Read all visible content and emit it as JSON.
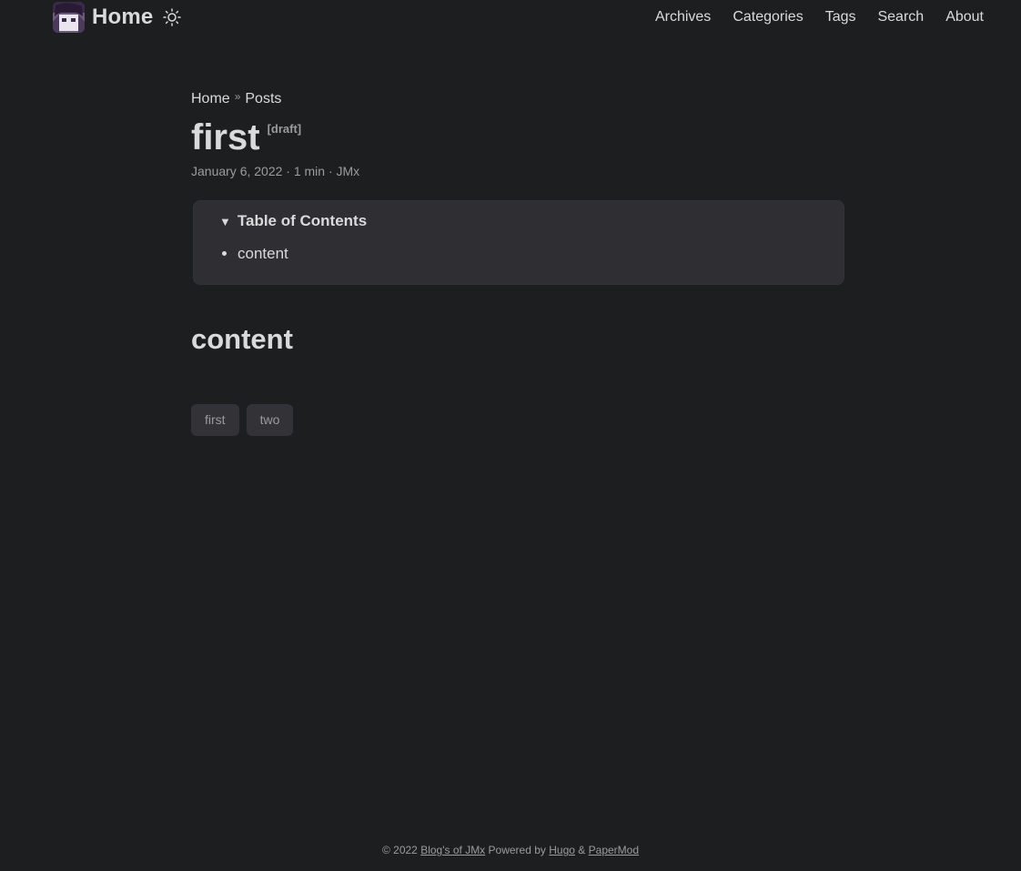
{
  "header": {
    "home_label": "Home",
    "nav": [
      "Archives",
      "Categories",
      "Tags",
      "Search",
      "About"
    ]
  },
  "breadcrumb": {
    "home": "Home",
    "separator": "»",
    "section": "Posts"
  },
  "post": {
    "title": "first",
    "draft_label": "[draft]",
    "meta": "January 6, 2022 · 1 min · JMx"
  },
  "toc": {
    "caret": "▼",
    "title": "Table of Contents",
    "items": [
      "content"
    ]
  },
  "content": {
    "heading": "content"
  },
  "tags": [
    "first",
    "two"
  ],
  "footer": {
    "copyright": "© 2022",
    "site_name": "Blog's of JMx",
    "powered_by": "Powered by",
    "hugo": "Hugo",
    "amp": "&",
    "theme": "PaperMod"
  },
  "colors": {
    "background": "#1d1e20",
    "text": "#dadadb",
    "secondary": "#9b9c9d",
    "card": "#2e2e33"
  }
}
